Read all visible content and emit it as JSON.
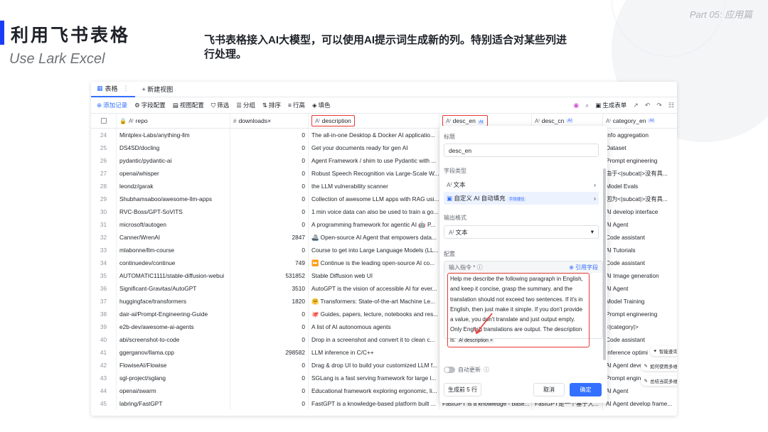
{
  "slide": {
    "part_label": "Part 05:   应用篇",
    "title_cn": "利用飞书表格",
    "title_en": "Use Lark Excel",
    "intro": "飞书表格接入AI大模型，可以使用AI提示词生成新的列。特别适合对某些列进行处理。"
  },
  "tabs": [
    {
      "label": "表格",
      "icon": "table-icon"
    },
    {
      "label": "+ 新建视图",
      "icon": "plus-icon"
    }
  ],
  "toolbar": {
    "add_record": "添加记录",
    "field_config": "字段配置",
    "view_config": "视图配置",
    "filter": "筛选",
    "group": "分组",
    "sort": "排序",
    "row_height": "行高",
    "fill_color": "填色",
    "generate_form": "生成表单"
  },
  "columns": [
    {
      "label": "repo",
      "icon": "Aᴵ"
    },
    {
      "label": "downloads×",
      "icon": "#"
    },
    {
      "label": "description",
      "icon": "Aᴵ"
    },
    {
      "label": "desc_en",
      "icon": "Aᴵ",
      "ai": "AI"
    },
    {
      "label": "desc_cn",
      "icon": "Aᴵ",
      "ai": "AI"
    },
    {
      "label": "category_en",
      "icon": "Aᴵ",
      "ai": "AI"
    }
  ],
  "rows": [
    {
      "n": "24",
      "repo": "Mintplex-Labs/anything-llm",
      "dl": "0",
      "desc": "The all-in-one Desktop & Docker AI applicatio...",
      "en": "",
      "cn": "",
      "cat": "Info aggregation"
    },
    {
      "n": "25",
      "repo": "DS4SD/docling",
      "dl": "0",
      "desc": "Get your documents ready for gen AI",
      "en": "",
      "cn": "",
      "cat": "Dataset"
    },
    {
      "n": "26",
      "repo": "pydantic/pydantic-ai",
      "dl": "0",
      "desc": "Agent Framework / shim to use Pydantic with ...",
      "en": "",
      "cn": "",
      "cat": "Prompt engineering"
    },
    {
      "n": "27",
      "repo": "openai/whisper",
      "dl": "0",
      "desc": "Robust Speech Recognition via Large-Scale W...",
      "en": "",
      "cn": "",
      "cat": "由于<|subcat|>没有具..."
    },
    {
      "n": "28",
      "repo": "leondz/garak",
      "dl": "0",
      "desc": "the LLM vulnerability scanner",
      "en": "",
      "cn": "",
      "cat": "Model Evals"
    },
    {
      "n": "29",
      "repo": "Shubhamsaboo/awesome-llm-apps",
      "dl": "0",
      "desc": "Collection of awesome LLM apps with RAG usi...",
      "en": "",
      "cn": "",
      "cat": "因为<|subcat|>没有具..."
    },
    {
      "n": "30",
      "repo": "RVC-Boss/GPT-SoVITS",
      "dl": "0",
      "desc": "1 min voice data can also be used to train a go...",
      "en": "",
      "cn": "",
      "cat": "AI develop interface"
    },
    {
      "n": "31",
      "repo": "microsoft/autogen",
      "dl": "0",
      "desc": "A programming framework for agentic AI 🤖 P...",
      "en": "",
      "cn": "",
      "cat": "AI Agent"
    },
    {
      "n": "32",
      "repo": "Canner/WrenAI",
      "dl": "2847",
      "desc": "🚢 Open-source AI Agent that empowers data...",
      "en": "",
      "cn": "",
      "cat": "Code assistant"
    },
    {
      "n": "33",
      "repo": "mlabonne/llm-course",
      "dl": "0",
      "desc": "Course to get into Large Language Models (LL...",
      "en": "",
      "cn": "",
      "cat": "AI Tutorials"
    },
    {
      "n": "34",
      "repo": "continuedev/continue",
      "dl": "749",
      "desc": "⏩ Continue is the leading open-source AI co...",
      "en": "",
      "cn": "",
      "cat": "Code assistant"
    },
    {
      "n": "35",
      "repo": "AUTOMATIC1111/stable-diffusion-webui",
      "dl": "531852",
      "desc": "Stable Diffusion web UI",
      "en": "",
      "cn": "",
      "cat": "AI Image generation"
    },
    {
      "n": "36",
      "repo": "Significant-Gravitas/AutoGPT",
      "dl": "3510",
      "desc": "AutoGPT is the vision of accessible AI for ever...",
      "en": "",
      "cn": "",
      "cat": "AI Agent"
    },
    {
      "n": "37",
      "repo": "huggingface/transformers",
      "dl": "1820",
      "desc": "🤗 Transformers: State-of-the-art Machine Le...",
      "en": "",
      "cn": "",
      "cat": "Model Training"
    },
    {
      "n": "38",
      "repo": "dair-ai/Prompt-Engineering-Guide",
      "dl": "0",
      "desc": "🐙 Guides, papers, lecture, notebooks and res...",
      "en": "",
      "cn": "",
      "cat": "Prompt engineering"
    },
    {
      "n": "39",
      "repo": "e2b-dev/awesome-ai-agents",
      "dl": "0",
      "desc": "A list of AI autonomous agents",
      "en": "",
      "cn": "",
      "cat": "<|category|>"
    },
    {
      "n": "40",
      "repo": "abi/screenshot-to-code",
      "dl": "0",
      "desc": "Drop in a screenshot and convert it to clean c...",
      "en": "",
      "cn": "",
      "cat": "Code assistant"
    },
    {
      "n": "41",
      "repo": "ggerganov/llama.cpp",
      "dl": "298582",
      "desc": "LLM inference in C/C++",
      "en": "",
      "cn": "",
      "cat": "Inference optimi"
    },
    {
      "n": "42",
      "repo": "FlowiseAI/Flowise",
      "dl": "0",
      "desc": "Drag & drop UI to build your customized LLM f...",
      "en": "",
      "cn": "",
      "cat": "AI Agent deve"
    },
    {
      "n": "43",
      "repo": "sgl-project/sglang",
      "dl": "0",
      "desc": "SGLang is a fast serving framework for large l...",
      "en": "",
      "cn": "",
      "cat": "Prompt engin"
    },
    {
      "n": "44",
      "repo": "openai/swarm",
      "dl": "0",
      "desc": "Educational framework exploring ergonomic, li...",
      "en": "",
      "cn": "",
      "cat": "AI Agent"
    },
    {
      "n": "45",
      "repo": "labring/FastGPT",
      "dl": "0",
      "desc": "FastGPT is a knowledge-based platform built ...",
      "en": "FastGPT is a knowledge - base...",
      "cn": "FastGPT是一个基于大...",
      "cat": "AI Agent develop frame..."
    }
  ],
  "panel": {
    "title_label": "标题",
    "title_value": "desc_en",
    "field_type_label": "字段类型",
    "type_text": "文本",
    "type_ai": "自定义 AI 自动填充",
    "type_ai_badge": "字段捷径",
    "output_label": "输出格式",
    "output_value": "文本",
    "config_label": "配置",
    "prompt_label": "输入指令 *",
    "ref_field": "⊕ 引用字段",
    "prompt_text": "Help me describe the following paragraph in English, and keep it concise, grasp the summary, and the translation should not exceed two sentences. If it's in English, then just make it simple. If you don't provide a value, you don't translate and just output empty. Only English translations are output. The description is:",
    "prompt_chip": "Aᴵ description ×",
    "auto_update": "自动更新",
    "gen_button": "生成前 5 行",
    "cancel_button": "取消",
    "ok_button": "确定"
  },
  "side_tips": [
    "智能查询",
    "如何使用多维",
    "总结当前多维"
  ]
}
